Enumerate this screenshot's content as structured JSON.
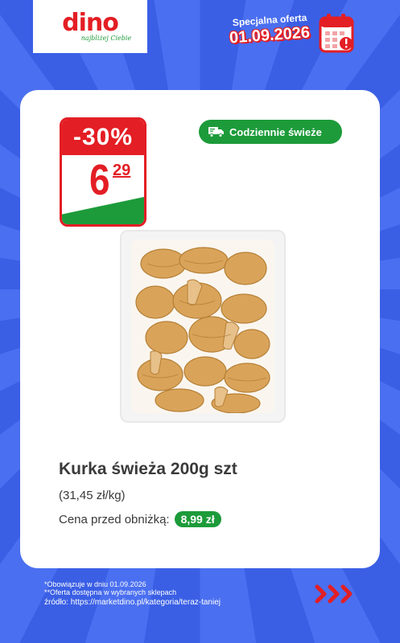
{
  "brand": {
    "name": "dino",
    "tagline": "najbliżej Ciebie",
    "red": "#e31e24",
    "green": "#1d9b3a",
    "blue": "#3d62e6"
  },
  "promo": {
    "label": "Specjalna oferta",
    "date": "01.09.2026",
    "icon": "calendar-alert-icon"
  },
  "badge": {
    "discount": "-30%",
    "price_int": "6",
    "price_dec": "29"
  },
  "fresh": {
    "label": "Codziennie świeże",
    "icon": "delivery-truck-icon"
  },
  "product": {
    "name": "Kurka świeża 200g szt",
    "unit_price": "(31,45 zł/kg)",
    "prev_price_label": "Cena przed obniżką:",
    "prev_price_value": "8,99 zł",
    "image": "chanterelle-mushrooms-tray"
  },
  "footer": {
    "note1": "*Obowiązuje w dniu 01.09.2026",
    "note2": "**Oferta dostępna w wybranych sklepach",
    "source": "źródło: https://marketdino.pl/kategoria/teraz-taniej",
    "arrows_icon": "triple-chevron-right-icon"
  }
}
